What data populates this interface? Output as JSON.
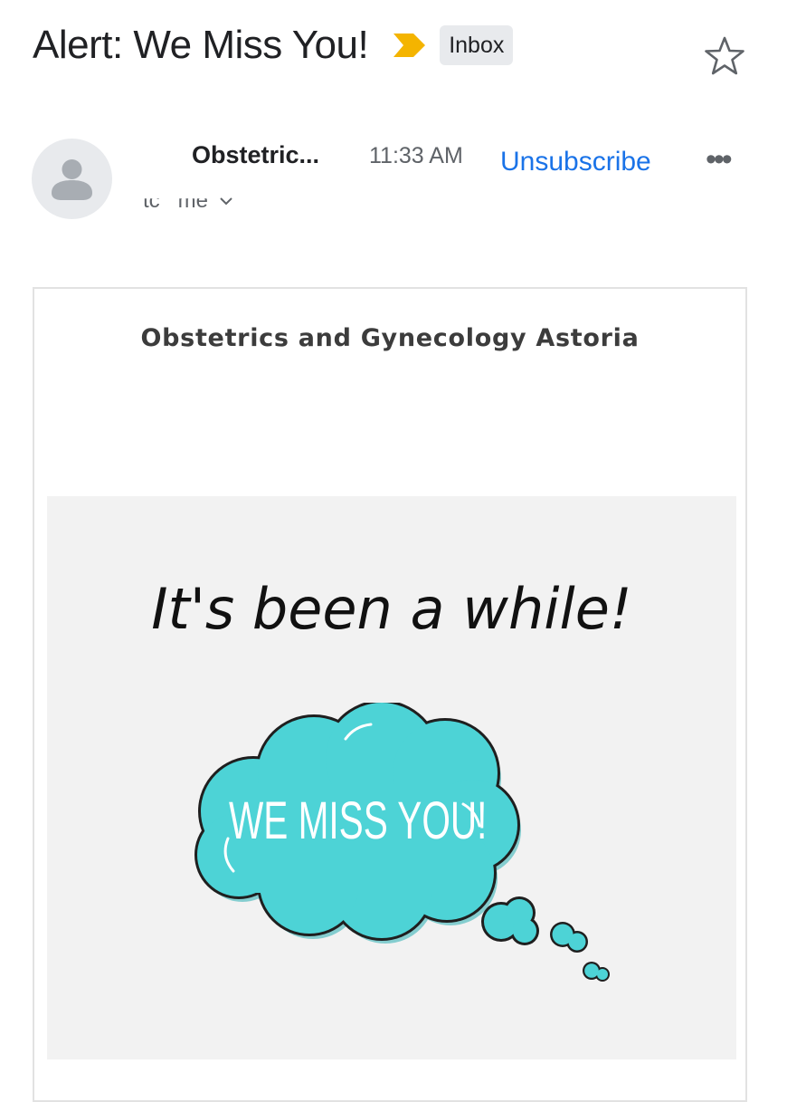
{
  "header": {
    "subject": "Alert: We Miss You!",
    "label_badge": "Inbox"
  },
  "message": {
    "sender": "Obstetric...",
    "time": "11:33 AM",
    "unsubscribe_label": "Unsubscribe",
    "recipient_fragment_1": "tc",
    "recipient_fragment_2": "me"
  },
  "email_body": {
    "clinic_name": "Obstetrics and Gynecology Astoria",
    "tagline": "It's been a while!",
    "cloud_text": "WE MISS YOU!"
  },
  "colors": {
    "accent_link": "#1a73e8",
    "importance_marker": "#f4b400",
    "cloud_fill": "#4dd3d6"
  },
  "icons": [
    "importance-marker-icon",
    "star-icon",
    "avatar-person-icon",
    "more-options-icon",
    "chevron-down-icon"
  ]
}
